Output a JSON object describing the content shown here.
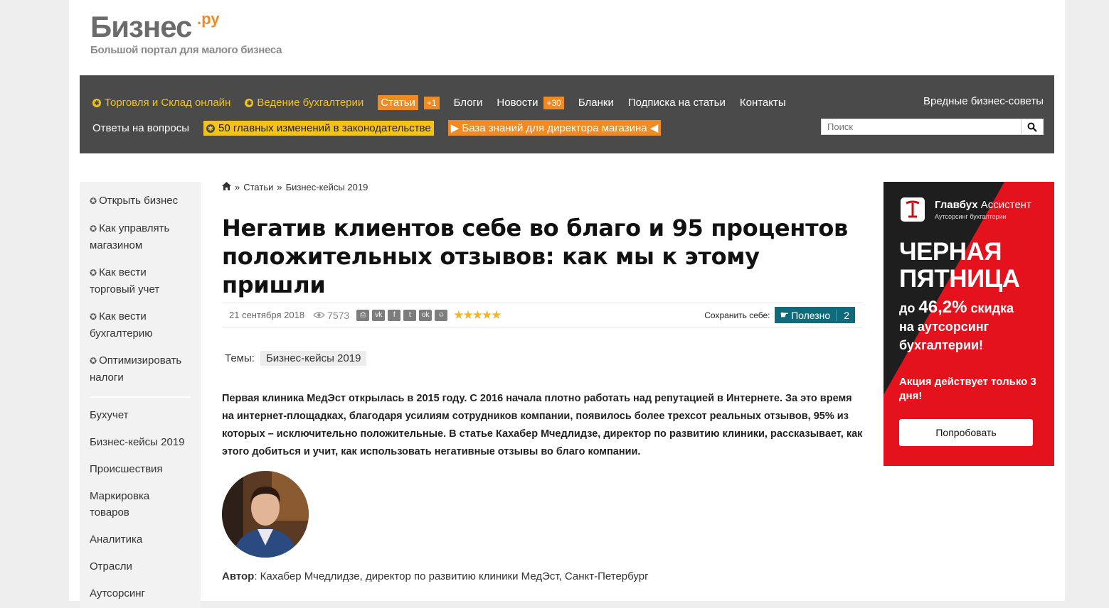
{
  "site": {
    "logo_text": "Бизнес",
    "logo_suffix": ".ру",
    "tagline": "Большой портал для малого бизнеса"
  },
  "nav": {
    "row1": [
      "Торговля и Склад онлайн",
      "Ведение бухгалтерии",
      "Статьи",
      "+1",
      "Блоги",
      "Новости",
      "+30",
      "Бланки",
      "Подписка на статьи",
      "Контакты"
    ],
    "row2": [
      "Ответы на вопросы",
      "50 главных изменений в законодательстве",
      "База знаний для директора магазина"
    ],
    "right_link": "Вредные бизнес-советы",
    "search_placeholder": "Поиск"
  },
  "sidebar": {
    "top_items": [
      "Открыть бизнес",
      "Как управлять магазином",
      "Как вести торговый учет",
      "Как вести бухгалтерию",
      "Оптимизировать налоги"
    ],
    "bottom_items": [
      "Бухучет",
      "Бизнес-кейсы 2019",
      "Происшествия",
      "Маркировка товаров",
      "Аналитика",
      "Отрасли",
      "Аутсорсинг"
    ]
  },
  "breadcrumb": [
    "»",
    "Статьи",
    "»",
    "Бизнес-кейсы 2019"
  ],
  "article": {
    "title": "Негатив клиентов себе во благо и 95 процентов положительных отзывов: как мы к этому пришли",
    "date": "21 сентября 2018",
    "views": "7573",
    "save_label": "Сохранить себе:",
    "useful_label": "Полезно",
    "useful_count": "2",
    "themes_label": "Темы:",
    "theme": "Бизнес-кейсы 2019",
    "lead": "Первая клиника МедЭст открылась в 2015 году. С 2016 начала плотно работать над репутацией в Интернете. За это время на интернет-площадках, благодаря усилиям сотрудников компании, появилось более трехсот реальных отзывов, 95% из которых – исключительно положительные. В статье Кахабер Мчедлидзе, директор по развитию клиники, рассказывает, как этого добиться и учит, как использовать негативные отзывы во благо компании.",
    "author_label": "Автор",
    "author_text": ": Кахабер Мчедлидзе, директор по развитию клиники МедЭст, Санкт-Петербург",
    "rating_stars": 5
  },
  "ad": {
    "brand": "Главбух",
    "brand_suffix": "Ассистент",
    "brand_sub": "Аутсорсинг бухгалтерии",
    "headline1": "ЧЕРНАЯ",
    "headline2": "ПЯТНИЦА",
    "offer_prefix": "до ",
    "offer_value": "46,2%",
    "offer_suffix": " скидка",
    "offer_line2": "на аутсорсинг",
    "offer_line3": "бухгалтерии!",
    "note": "Акция действует только 3 дня!",
    "button": "Попробовать"
  },
  "colors": {
    "accent_orange": "#f08a24",
    "accent_yellow": "#f3c21b",
    "nav_bg": "#4a4a4a",
    "useful_btn": "#0f6b7c",
    "ad_red": "#e3121c"
  }
}
